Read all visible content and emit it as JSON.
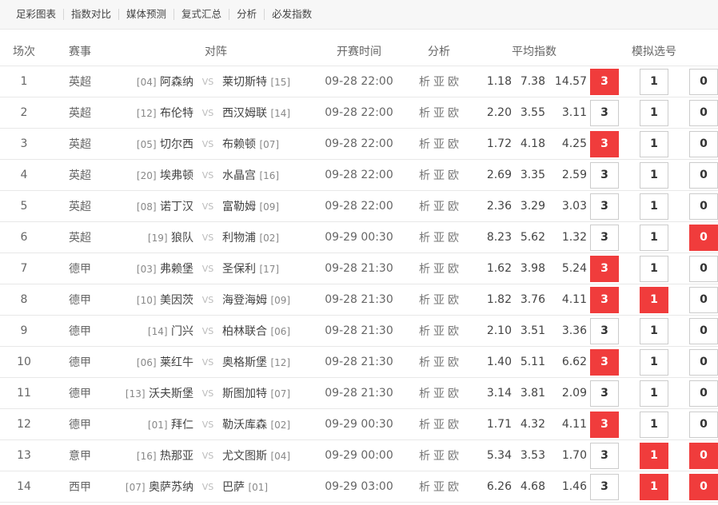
{
  "nav": [
    "足彩图表",
    "指数对比",
    "媒体预测",
    "复式汇总",
    "分析",
    "必发指数"
  ],
  "headers": {
    "no": "场次",
    "league": "赛事",
    "match": "对阵",
    "time": "开赛时间",
    "analysis": "分析",
    "odds": "平均指数",
    "pick": "模拟选号"
  },
  "analysis_links": [
    "析",
    "亚",
    "欧"
  ],
  "vs_label": "VS",
  "pick_labels": [
    "3",
    "1",
    "0"
  ],
  "colors": {
    "selected": "#f03c3c"
  },
  "rows": [
    {
      "no": "1",
      "league": "英超",
      "home_rank": "[04]",
      "home": "阿森纳",
      "away": "莱切斯特",
      "away_rank": "[15]",
      "time": "09-28 22:00",
      "odds": [
        "1.18",
        "7.38",
        "14.57"
      ],
      "selected": [
        "3"
      ]
    },
    {
      "no": "2",
      "league": "英超",
      "home_rank": "[12]",
      "home": "布伦特",
      "away": "西汉姆联",
      "away_rank": "[14]",
      "time": "09-28 22:00",
      "odds": [
        "2.20",
        "3.55",
        "3.11"
      ],
      "selected": []
    },
    {
      "no": "3",
      "league": "英超",
      "home_rank": "[05]",
      "home": "切尔西",
      "away": "布赖顿",
      "away_rank": "[07]",
      "time": "09-28 22:00",
      "odds": [
        "1.72",
        "4.18",
        "4.25"
      ],
      "selected": [
        "3"
      ]
    },
    {
      "no": "4",
      "league": "英超",
      "home_rank": "[20]",
      "home": "埃弗顿",
      "away": "水晶宫",
      "away_rank": "[16]",
      "time": "09-28 22:00",
      "odds": [
        "2.69",
        "3.35",
        "2.59"
      ],
      "selected": []
    },
    {
      "no": "5",
      "league": "英超",
      "home_rank": "[08]",
      "home": "诺丁汉",
      "away": "富勒姆",
      "away_rank": "[09]",
      "time": "09-28 22:00",
      "odds": [
        "2.36",
        "3.29",
        "3.03"
      ],
      "selected": []
    },
    {
      "no": "6",
      "league": "英超",
      "home_rank": "[19]",
      "home": "狼队",
      "away": "利物浦",
      "away_rank": "[02]",
      "time": "09-29 00:30",
      "odds": [
        "8.23",
        "5.62",
        "1.32"
      ],
      "selected": [
        "0"
      ]
    },
    {
      "no": "7",
      "league": "德甲",
      "home_rank": "[03]",
      "home": "弗赖堡",
      "away": "圣保利",
      "away_rank": "[17]",
      "time": "09-28 21:30",
      "odds": [
        "1.62",
        "3.98",
        "5.24"
      ],
      "selected": [
        "3"
      ]
    },
    {
      "no": "8",
      "league": "德甲",
      "home_rank": "[10]",
      "home": "美因茨",
      "away": "海登海姆",
      "away_rank": "[09]",
      "time": "09-28 21:30",
      "odds": [
        "1.82",
        "3.76",
        "4.11"
      ],
      "selected": [
        "3",
        "1"
      ]
    },
    {
      "no": "9",
      "league": "德甲",
      "home_rank": "[14]",
      "home": "门兴",
      "away": "柏林联合",
      "away_rank": "[06]",
      "time": "09-28 21:30",
      "odds": [
        "2.10",
        "3.51",
        "3.36"
      ],
      "selected": []
    },
    {
      "no": "10",
      "league": "德甲",
      "home_rank": "[06]",
      "home": "莱红牛",
      "away": "奥格斯堡",
      "away_rank": "[12]",
      "time": "09-28 21:30",
      "odds": [
        "1.40",
        "5.11",
        "6.62"
      ],
      "selected": [
        "3"
      ]
    },
    {
      "no": "11",
      "league": "德甲",
      "home_rank": "[13]",
      "home": "沃夫斯堡",
      "away": "斯图加特",
      "away_rank": "[07]",
      "time": "09-28 21:30",
      "odds": [
        "3.14",
        "3.81",
        "2.09"
      ],
      "selected": []
    },
    {
      "no": "12",
      "league": "德甲",
      "home_rank": "[01]",
      "home": "拜仁",
      "away": "勒沃库森",
      "away_rank": "[02]",
      "time": "09-29 00:30",
      "odds": [
        "1.71",
        "4.32",
        "4.11"
      ],
      "selected": [
        "3"
      ]
    },
    {
      "no": "13",
      "league": "意甲",
      "home_rank": "[16]",
      "home": "热那亚",
      "away": "尤文图斯",
      "away_rank": "[04]",
      "time": "09-29 00:00",
      "odds": [
        "5.34",
        "3.53",
        "1.70"
      ],
      "selected": [
        "1",
        "0"
      ]
    },
    {
      "no": "14",
      "league": "西甲",
      "home_rank": "[07]",
      "home": "奥萨苏纳",
      "away": "巴萨",
      "away_rank": "[01]",
      "time": "09-29 03:00",
      "odds": [
        "6.26",
        "4.68",
        "1.46"
      ],
      "selected": [
        "1",
        "0"
      ]
    }
  ]
}
